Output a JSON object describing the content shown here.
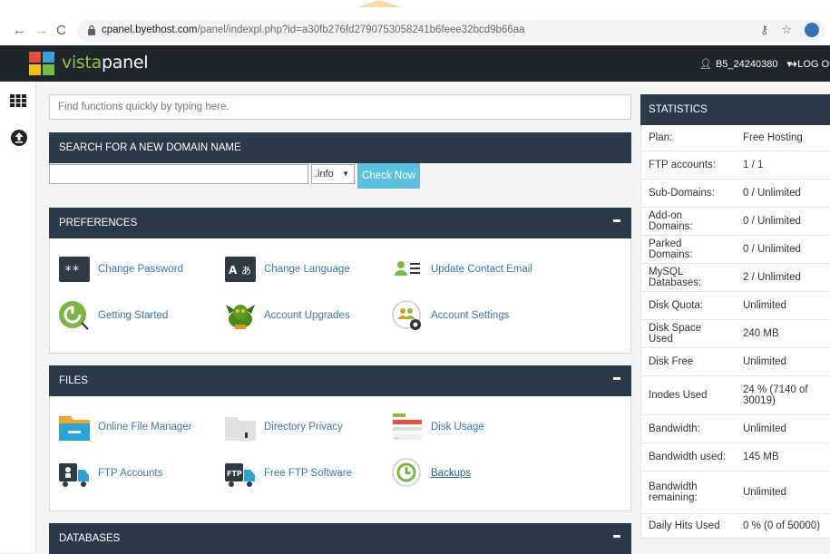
{
  "browser": {
    "back_icon": "arrow-left-icon",
    "forward_icon": "arrow-right-icon",
    "reload_icon": "reload-icon",
    "url_host": "cpanel.byethost.com",
    "url_path": "/panel/indexpl.php?id=a30fb276fd2790753058241b6feee32bcd9b66aa"
  },
  "header": {
    "logo_part1": "vista",
    "logo_part2": "panel",
    "username": "B5_24240380",
    "logout_label": "LOG OU"
  },
  "search": {
    "placeholder": "Find functions quickly by typing here."
  },
  "domain_search": {
    "title": "SEARCH FOR A NEW DOMAIN NAME",
    "tld_selected": ".info",
    "button_label": "Check Now"
  },
  "preferences": {
    "title": "PREFERENCES",
    "items": [
      {
        "label": "Change Password",
        "icon": "password-icon"
      },
      {
        "label": "Change Language",
        "icon": "language-icon"
      },
      {
        "label": "Update Contact Email",
        "icon": "contact-card-icon"
      },
      {
        "label": "Getting Started",
        "icon": "getting-started-icon"
      },
      {
        "label": "Account Upgrades",
        "icon": "dragon-icon"
      },
      {
        "label": "Account Settings",
        "icon": "account-settings-icon"
      }
    ]
  },
  "files": {
    "title": "FILES",
    "items": [
      {
        "label": "Online File Manager",
        "icon": "file-manager-icon"
      },
      {
        "label": "Directory Privacy",
        "icon": "folder-lock-icon"
      },
      {
        "label": "Disk Usage",
        "icon": "disk-usage-icon"
      },
      {
        "label": "FTP Accounts",
        "icon": "ftp-truck-icon"
      },
      {
        "label": "Free FTP Software",
        "icon": "ftp-software-icon"
      },
      {
        "label": "Backups",
        "icon": "backup-icon"
      }
    ]
  },
  "databases": {
    "title": "DATABASES"
  },
  "statistics": {
    "title": "STATISTICS",
    "rows": [
      {
        "key": "Plan:",
        "value": "Free Hosting"
      },
      {
        "key": "FTP accounts:",
        "value": "1 / 1"
      },
      {
        "key": "Sub-Domains:",
        "value": "0 / Unlimited"
      },
      {
        "key": "Add-on Domains:",
        "value": "0 / Unlimited"
      },
      {
        "key": "Parked Domains:",
        "value": "0 / Unlimited"
      },
      {
        "key": "MySQL Databases:",
        "value": "2 / Unlimited"
      },
      {
        "key": "Disk Quota:",
        "value": "Unlimited"
      },
      {
        "key": "Disk Space Used",
        "value": "240 MB"
      },
      {
        "key": "Disk Free",
        "value": "Unlimited"
      },
      {
        "key": "Inodes Used",
        "value": "24 % (7140 of 30019)"
      },
      {
        "key": "Bandwidth:",
        "value": "Unlimited"
      },
      {
        "key": "Bandwidth used:",
        "value": "145 MB"
      },
      {
        "key": "Bandwidth remaining:",
        "value": "Unlimited"
      },
      {
        "key": "Daily Hits Used",
        "value": "0 % (0 of 50000)"
      }
    ]
  },
  "colors": {
    "header_bg": "#1e252b",
    "panel_head": "#2b3a48",
    "link": "#3a76b4",
    "button": "#5bc0de"
  }
}
